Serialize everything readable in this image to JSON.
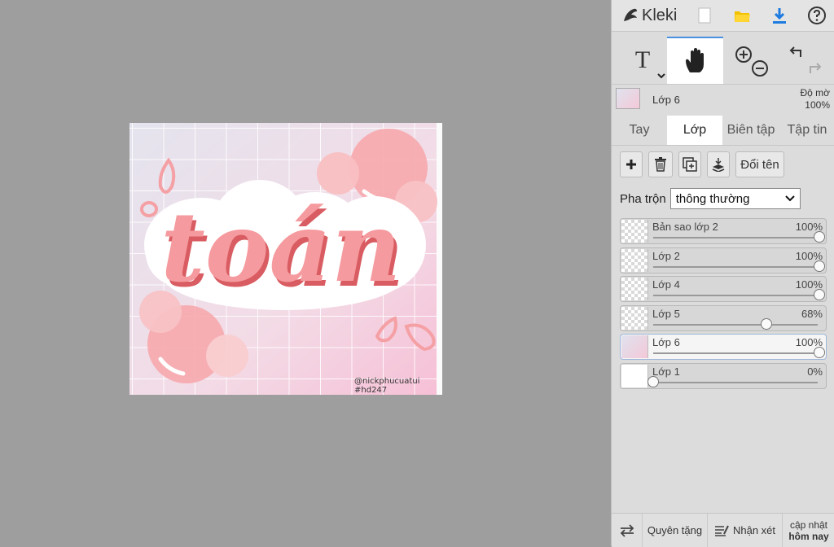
{
  "app": {
    "name": "Kleki"
  },
  "colors": {
    "accent": "#4a90e2",
    "download": "#1e7be0",
    "folder": "#f2c200",
    "pink": "#f59a9e",
    "bubble": "#f7b6b8"
  },
  "toolbar": {
    "icons": [
      "new-image-icon",
      "open-folder-icon",
      "download-icon",
      "help-icon"
    ],
    "tools": [
      "text-tool",
      "hand-tool",
      "zoom-tool",
      "undo-redo"
    ],
    "text_tool_label": "T"
  },
  "current_layer": {
    "name": "Lớp 6",
    "opacity_label": "Độ mờ",
    "opacity": "100%"
  },
  "tabs": [
    "Tay",
    "Lớp",
    "Biên tập",
    "Tập tin"
  ],
  "active_tab": "Lớp",
  "layer_actions": {
    "rename": "Đổi tên"
  },
  "blend": {
    "label": "Pha trộn",
    "value": "thông thường"
  },
  "layers": [
    {
      "name": "Bản sao lớp 2",
      "opacity": "100%",
      "level": 1.0
    },
    {
      "name": "Lớp 2",
      "opacity": "100%",
      "level": 1.0
    },
    {
      "name": "Lớp 4",
      "opacity": "100%",
      "level": 1.0
    },
    {
      "name": "Lớp 5",
      "opacity": "68%",
      "level": 0.68
    },
    {
      "name": "Lớp 6",
      "opacity": "100%",
      "level": 1.0,
      "selected": true
    },
    {
      "name": "Lớp 1",
      "opacity": "0%",
      "level": 0.0
    }
  ],
  "artwork": {
    "word": "toán",
    "credit1": "@nickphucuatui",
    "credit2": "#hd247"
  },
  "bottom": {
    "donate": "Quyên tặng",
    "feedback": "Nhận xét",
    "update_line1": "cập nhật",
    "update_line2": "hôm nay"
  }
}
